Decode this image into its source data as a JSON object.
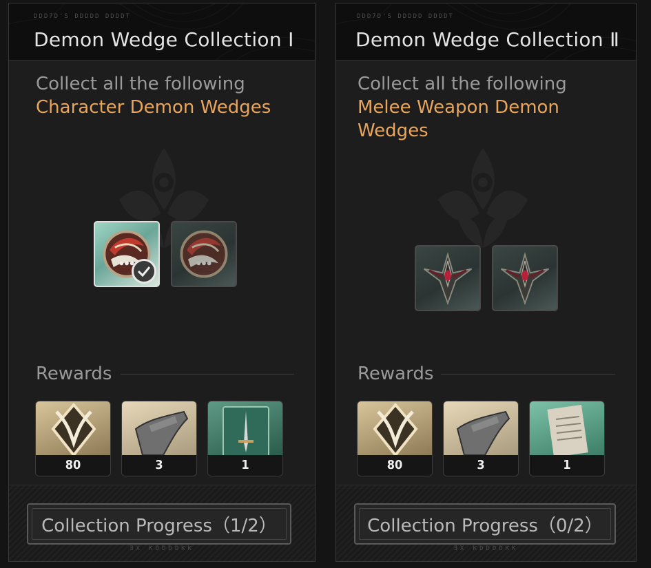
{
  "cards": [
    {
      "header_sub": "DDD7D'S DDDDD DDDDT",
      "title": "Demon Wedge Collection Ⅰ",
      "desc_lead": "Collect all the following",
      "desc_highlight": "Character Demon Wedges",
      "wedge_type": "character",
      "wedges": [
        {
          "state": "collected",
          "icon": "character-wedge-icon"
        },
        {
          "state": "not-collected",
          "icon": "character-wedge-icon"
        }
      ],
      "rewards_label": "Rewards",
      "rewards": [
        {
          "icon": "demon-emblem-icon",
          "qty": "80"
        },
        {
          "icon": "scroll-quill-icon",
          "qty": "3"
        },
        {
          "icon": "sword-book-icon",
          "qty": "1"
        }
      ],
      "progress_label": "Collection Progress（1/2）",
      "footer_glyphs": "ƎX ƘDDDDƘƘ",
      "progress": {
        "collected": 1,
        "total": 2
      }
    },
    {
      "header_sub": "DDD7D'S DDDDD DDDDT",
      "title": "Demon Wedge Collection Ⅱ",
      "desc_lead": "Collect all the following",
      "desc_highlight": "Melee Weapon Demon Wedges",
      "wedge_type": "melee",
      "wedges": [
        {
          "state": "not-collected",
          "icon": "melee-wedge-icon"
        },
        {
          "state": "not-collected",
          "icon": "melee-wedge-icon"
        }
      ],
      "rewards_label": "Rewards",
      "rewards": [
        {
          "icon": "demon-emblem-icon",
          "qty": "80"
        },
        {
          "icon": "scroll-quill-icon",
          "qty": "3"
        },
        {
          "icon": "paper-scroll-icon",
          "qty": "1"
        }
      ],
      "progress_label": "Collection Progress（0/2）",
      "footer_glyphs": "ƎX ƘDDDDƘƘ",
      "progress": {
        "collected": 0,
        "total": 2
      }
    }
  ],
  "colors": {
    "highlight": "#e8a55b",
    "muted_text": "#9a9a9a",
    "title_text": "#e4e4e4",
    "panel_bg": "#1d1d1d"
  }
}
